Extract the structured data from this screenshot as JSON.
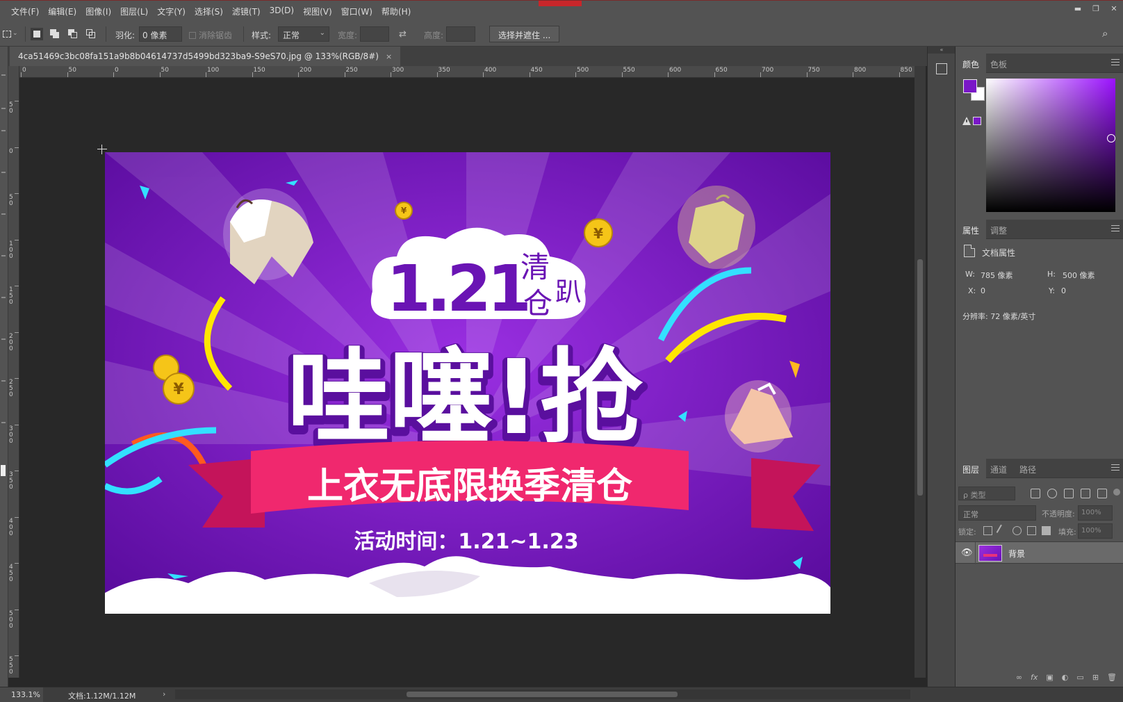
{
  "menu": {
    "items": [
      "文件(F)",
      "编辑(E)",
      "图像(I)",
      "图层(L)",
      "文字(Y)",
      "选择(S)",
      "滤镜(T)",
      "3D(D)",
      "视图(V)",
      "窗口(W)",
      "帮助(H)"
    ]
  },
  "options": {
    "feather_label": "羽化:",
    "feather_value": "0 像素",
    "antialias_label": "消除锯齿",
    "style_label": "样式:",
    "style_value": "正常",
    "width_label": "宽度:",
    "height_label": "高度:",
    "select_mask_button": "选择并遮住 ..."
  },
  "document": {
    "tab_title": "4ca51469c3bc08fa151a9b8b04614737d5499bd323ba9-S9eS70.jpg @ 133%(RGB/8#)",
    "close_glyph": "×"
  },
  "rulers": {
    "h_labels": [
      "0",
      "50",
      "0",
      "50",
      "100",
      "150",
      "200",
      "250",
      "300",
      "350",
      "400",
      "450",
      "500",
      "550",
      "600",
      "650",
      "700",
      "750",
      "800",
      "850"
    ],
    "v_labels": [
      "50",
      "0",
      "50",
      "100",
      "150",
      "200",
      "250",
      "300",
      "350",
      "400",
      "450",
      "500",
      "550"
    ]
  },
  "artwork": {
    "date_title": "1.21",
    "title_chars_a": "清",
    "title_chars_b": "仓",
    "title_chars_c": "趴",
    "headline": "哇噻!抢",
    "ribbon_text": "上衣无底限换季清仓",
    "date_range": "活动时间：1.21~1.23",
    "coin_glyph": "¥"
  },
  "status": {
    "zoom": "133.1%",
    "doc_info": "文档:1.12M/1.12M",
    "arrow": "›"
  },
  "panels": {
    "color_tabs": [
      "颜色",
      "色板"
    ],
    "fg_color": "#7a17c8",
    "props_tabs": [
      "属性",
      "调整"
    ],
    "doc_props_title": "文档属性",
    "w_label": "W:",
    "w_value": "785 像素",
    "h_label": "H:",
    "h_value": "500 像素",
    "x_label": "X:",
    "x_value": "0",
    "y_label": "Y:",
    "y_value": "0",
    "resolution": "分辨率: 72 像素/英寸",
    "layers_tabs": [
      "图层",
      "通道",
      "路径"
    ],
    "search_placeholder": "ρ 类型",
    "blend_mode": "正常",
    "opacity_label": "不透明度:",
    "opacity_value": "100%",
    "lock_label": "锁定:",
    "fill_label": "填充:",
    "fill_value": "100%",
    "layer_name": "背景",
    "footer_icons": [
      "∞",
      "fx"
    ]
  }
}
